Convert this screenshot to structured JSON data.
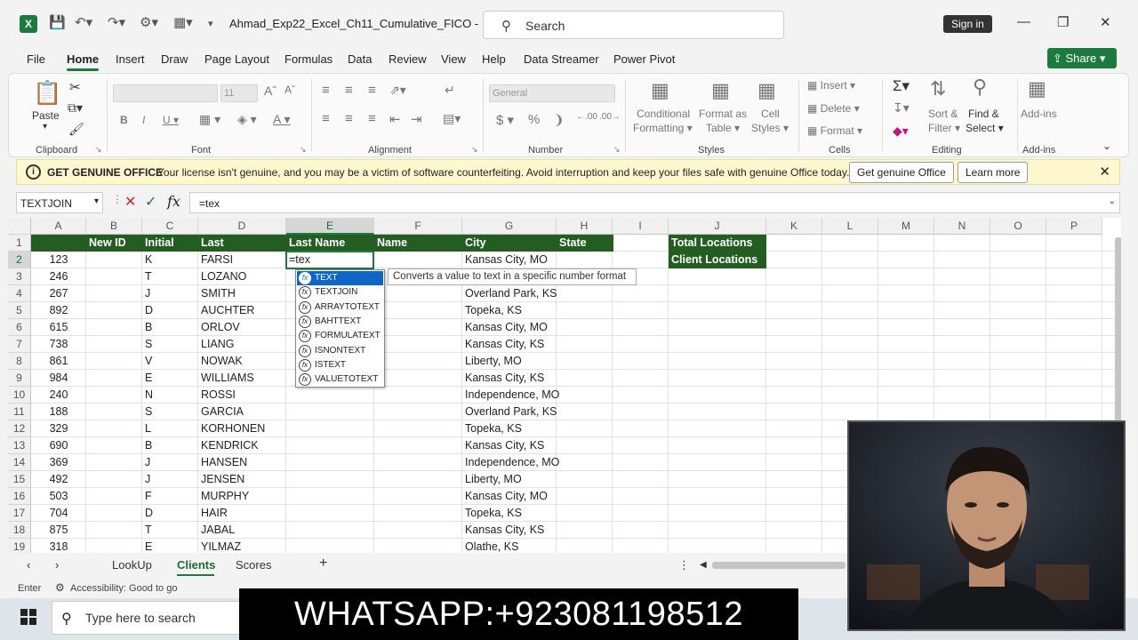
{
  "window": {
    "doc_title": "Ahmad_Exp22_Excel_Ch11_Cumulative_FICO  -",
    "search_label": "Search",
    "signin": "Sign in",
    "app_icon": "X"
  },
  "menu": {
    "items": [
      "File",
      "Home",
      "Insert",
      "Draw",
      "Page Layout",
      "Formulas",
      "Data",
      "Review",
      "View",
      "Help",
      "Data Streamer",
      "Power Pivot"
    ],
    "active": "Home",
    "share": "Share"
  },
  "ribbon": {
    "clipboard": {
      "label": "Clipboard",
      "paste": "Paste"
    },
    "font": {
      "label": "Font",
      "size": "11"
    },
    "alignment": {
      "label": "Alignment"
    },
    "number": {
      "label": "Number",
      "format": "General"
    },
    "styles": {
      "label": "Styles",
      "conditional": "Conditional",
      "conditional2": "Formatting",
      "format_as": "Format as",
      "format_as2": "Table",
      "cell_styles": "Cell",
      "cell_styles2": "Styles"
    },
    "cells": {
      "label": "Cells",
      "insert": "Insert",
      "delete": "Delete",
      "format": "Format"
    },
    "editing": {
      "label": "Editing",
      "sort": "Sort &",
      "sort2": "Filter",
      "find": "Find &",
      "find2": "Select"
    },
    "addins": {
      "label": "Add-ins",
      "addins": "Add-ins"
    }
  },
  "license": {
    "heading": "GET GENUINE OFFICE",
    "message": "Your license isn't genuine, and you may be a victim of software counterfeiting. Avoid interruption and keep your files safe with genuine Office today.",
    "btn_genuine": "Get genuine Office",
    "btn_learn": "Learn more"
  },
  "formula_bar": {
    "name_box": "TEXTJOIN",
    "formula": "=tex"
  },
  "columns": [
    "A",
    "B",
    "C",
    "D",
    "E",
    "F",
    "G",
    "H",
    "I",
    "J",
    "K",
    "L",
    "M",
    "N",
    "O",
    "P"
  ],
  "header_row": {
    "a": "",
    "b": "New ID",
    "c": "Initial",
    "d": "Last",
    "e": "Last Name",
    "f": "Name",
    "g": "City",
    "h": "State",
    "j": "Total Locations"
  },
  "j2": "Client Locations",
  "rows": [
    {
      "n": "2",
      "a": "123",
      "c": "K",
      "d": "FARSI",
      "g": "Kansas City, MO"
    },
    {
      "n": "3",
      "a": "246",
      "c": "T",
      "d": "LOZANO",
      "g": ""
    },
    {
      "n": "4",
      "a": "267",
      "c": "J",
      "d": "SMITH",
      "g": "Overland Park, KS"
    },
    {
      "n": "5",
      "a": "892",
      "c": "D",
      "d": "AUCHTER",
      "g": "Topeka, KS"
    },
    {
      "n": "6",
      "a": "615",
      "c": "B",
      "d": "ORLOV",
      "g": "Kansas City, MO"
    },
    {
      "n": "7",
      "a": "738",
      "c": "S",
      "d": "LIANG",
      "g": "Kansas City, KS"
    },
    {
      "n": "8",
      "a": "861",
      "c": "V",
      "d": "NOWAK",
      "g": "Liberty, MO"
    },
    {
      "n": "9",
      "a": "984",
      "c": "E",
      "d": "WILLIAMS",
      "g": "Kansas City, KS"
    },
    {
      "n": "10",
      "a": "240",
      "c": "N",
      "d": "ROSSI",
      "g": "Independence, MO"
    },
    {
      "n": "11",
      "a": "188",
      "c": "S",
      "d": "GARCIA",
      "g": "Overland Park, KS"
    },
    {
      "n": "12",
      "a": "329",
      "c": "L",
      "d": "KORHONEN",
      "g": "Topeka, KS"
    },
    {
      "n": "13",
      "a": "690",
      "c": "B",
      "d": "KENDRICK",
      "g": "Kansas City, KS"
    },
    {
      "n": "14",
      "a": "369",
      "c": "J",
      "d": "HANSEN",
      "g": "Independence, MO"
    },
    {
      "n": "15",
      "a": "492",
      "c": "J",
      "d": "JENSEN",
      "g": "Liberty, MO"
    },
    {
      "n": "16",
      "a": "503",
      "c": "F",
      "d": "MURPHY",
      "g": "Kansas City, MO"
    },
    {
      "n": "17",
      "a": "704",
      "c": "D",
      "d": "HAIR",
      "g": "Topeka, KS"
    },
    {
      "n": "18",
      "a": "875",
      "c": "T",
      "d": "JABAL",
      "g": "Kansas City, KS"
    },
    {
      "n": "19",
      "a": "318",
      "c": "E",
      "d": "YILMAZ",
      "g": "Olathe, KS"
    }
  ],
  "active_cell_value": "=tex",
  "autocomplete": [
    "TEXT",
    "TEXTJOIN",
    "ARRAYTOTEXT",
    "BAHTTEXT",
    "FORMULATEXT",
    "ISNONTEXT",
    "ISTEXT",
    "VALUETOTEXT"
  ],
  "tooltip": "Converts a value to text in a specific number format",
  "tabs": [
    "LookUp",
    "Clients",
    "Scores"
  ],
  "active_tab": "Clients",
  "status": {
    "mode": "Enter",
    "accessibility": "Accessibility: Good to go"
  },
  "taskbar": {
    "search": "Type here to search"
  },
  "banner": "WHATSAPP:+923081198512",
  "colors": {
    "excel_green": "#1d7a3e",
    "header_fill": "#235d22",
    "selection_blue": "#0e67c4"
  }
}
